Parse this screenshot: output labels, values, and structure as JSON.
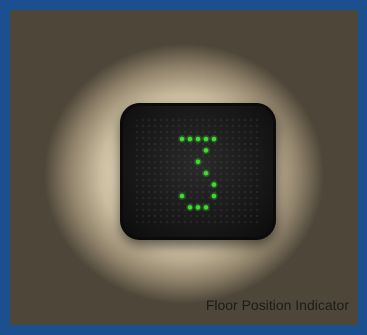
{
  "display": {
    "digit": "3",
    "led_color": "#3ddc2e"
  },
  "caption": "Floor Position Indicator",
  "colors": {
    "frame": "#1c4f8f",
    "panel": "#141414"
  }
}
